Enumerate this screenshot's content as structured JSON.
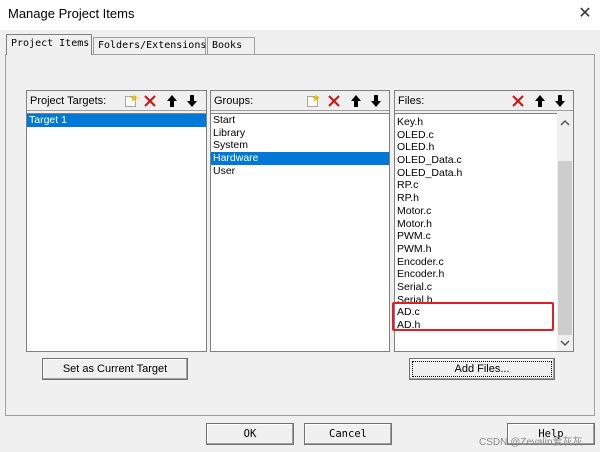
{
  "window": {
    "title": "Manage Project Items",
    "close_glyph": "✕"
  },
  "tabs": [
    {
      "label": "Project Items",
      "active": true
    },
    {
      "label": "Folders/Extensions",
      "active": false
    },
    {
      "label": "Books",
      "active": false
    }
  ],
  "targets": {
    "title": "Project Targets:",
    "items": [
      "Target 1"
    ],
    "selected": "Target 1",
    "tools": [
      "new-icon",
      "delete-icon",
      "move-up-icon",
      "move-down-icon"
    ]
  },
  "groups": {
    "title": "Groups:",
    "items": [
      "Start",
      "Library",
      "System",
      "Hardware",
      "User"
    ],
    "selected": "Hardware",
    "tools": [
      "new-icon",
      "delete-icon",
      "move-up-icon",
      "move-down-icon"
    ]
  },
  "files": {
    "title": "Files:",
    "items": [
      "Key.h",
      "OLED.c",
      "OLED.h",
      "OLED_Data.c",
      "OLED_Data.h",
      "RP.c",
      "RP.h",
      "Motor.c",
      "Motor.h",
      "PWM.c",
      "PWM.h",
      "Encoder.c",
      "Encoder.h",
      "Serial.c",
      "Serial.h",
      "AD.c",
      "AD.h"
    ],
    "highlighted": [
      "AD.c",
      "AD.h"
    ],
    "tools": [
      "delete-icon",
      "move-up-icon",
      "move-down-icon"
    ]
  },
  "buttons": {
    "set_target": "Set as Current Target",
    "add_files": "Add Files...",
    "ok": "OK",
    "cancel": "Cancel",
    "help": "Help"
  },
  "watermark": "CSDN @Zevalin爱灰灰",
  "colors": {
    "selection": "#0078d7",
    "highlight_box": "#e02020",
    "delete_x": "#d01010"
  }
}
